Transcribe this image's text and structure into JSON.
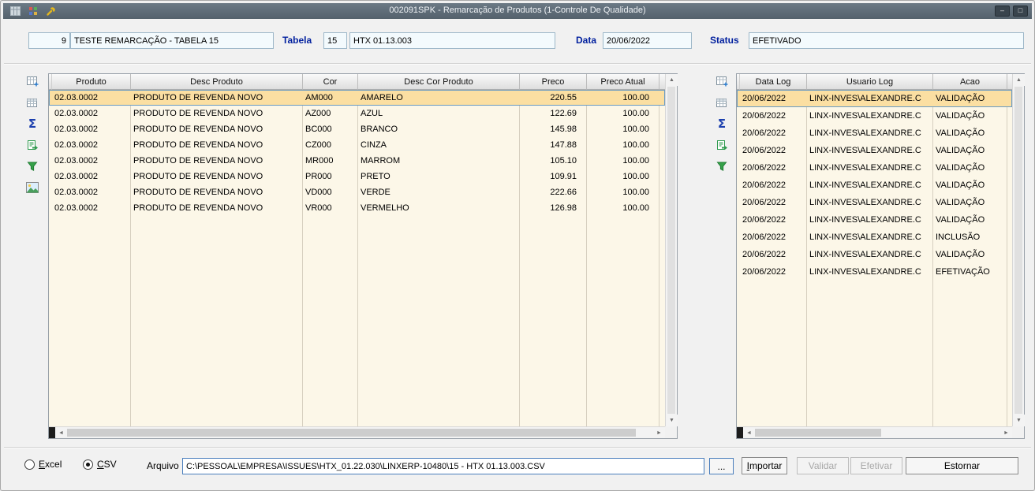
{
  "window": {
    "title": "002091SPK - Remarcação de Produtos (1-Controle De Qualidade)",
    "minimize_glyph": "–",
    "maximize_glyph": "□"
  },
  "header": {
    "record_id": "9",
    "record_description": "TESTE REMARCAÇÃO - TABELA 15",
    "tabela_label": "Tabela",
    "tabela_number": "15",
    "tabela_codigo": "HTX 01.13.003",
    "data_label": "Data",
    "data_value": "20/06/2022",
    "status_label": "Status",
    "status_value": "EFETIVADO"
  },
  "products_grid": {
    "columns": [
      "Produto",
      "Desc Produto",
      "Cor",
      "Desc Cor Produto",
      "Preco",
      "Preco Atual"
    ],
    "rows": [
      [
        "02.03.0002",
        "PRODUTO DE REVENDA NOVO",
        "AM000",
        "AMARELO",
        "220.55",
        "100.00"
      ],
      [
        "02.03.0002",
        "PRODUTO DE REVENDA NOVO",
        "AZ000",
        "AZUL",
        "122.69",
        "100.00"
      ],
      [
        "02.03.0002",
        "PRODUTO DE REVENDA NOVO",
        "BC000",
        "BRANCO",
        "145.98",
        "100.00"
      ],
      [
        "02.03.0002",
        "PRODUTO DE REVENDA NOVO",
        "CZ000",
        "CINZA",
        "147.88",
        "100.00"
      ],
      [
        "02.03.0002",
        "PRODUTO DE REVENDA NOVO",
        "MR000",
        "MARROM",
        "105.10",
        "100.00"
      ],
      [
        "02.03.0002",
        "PRODUTO DE REVENDA NOVO",
        "PR000",
        "PRETO",
        "109.91",
        "100.00"
      ],
      [
        "02.03.0002",
        "PRODUTO DE REVENDA NOVO",
        "VD000",
        "VERDE",
        "222.66",
        "100.00"
      ],
      [
        "02.03.0002",
        "PRODUTO DE REVENDA NOVO",
        "VR000",
        "VERMELHO",
        "126.98",
        "100.00"
      ]
    ]
  },
  "log_grid": {
    "columns": [
      "Data Log",
      "Usuario Log",
      "Acao"
    ],
    "rows": [
      [
        "20/06/2022",
        "LINX-INVES\\ALEXANDRE.C",
        "VALIDAÇÃO"
      ],
      [
        "20/06/2022",
        "LINX-INVES\\ALEXANDRE.C",
        "VALIDAÇÃO"
      ],
      [
        "20/06/2022",
        "LINX-INVES\\ALEXANDRE.C",
        "VALIDAÇÃO"
      ],
      [
        "20/06/2022",
        "LINX-INVES\\ALEXANDRE.C",
        "VALIDAÇÃO"
      ],
      [
        "20/06/2022",
        "LINX-INVES\\ALEXANDRE.C",
        "VALIDAÇÃO"
      ],
      [
        "20/06/2022",
        "LINX-INVES\\ALEXANDRE.C",
        "VALIDAÇÃO"
      ],
      [
        "20/06/2022",
        "LINX-INVES\\ALEXANDRE.C",
        "VALIDAÇÃO"
      ],
      [
        "20/06/2022",
        "LINX-INVES\\ALEXANDRE.C",
        "VALIDAÇÃO"
      ],
      [
        "20/06/2022",
        "LINX-INVES\\ALEXANDRE.C",
        "INCLUSÃO"
      ],
      [
        "20/06/2022",
        "LINX-INVES\\ALEXANDRE.C",
        "VALIDAÇÃO"
      ],
      [
        "20/06/2022",
        "LINX-INVES\\ALEXANDRE.C",
        "EFETIVAÇÃO"
      ]
    ]
  },
  "icons": {
    "sum_glyph": "Σ",
    "scroll_up": "▲",
    "scroll_down": "▼",
    "scroll_left": "◄",
    "scroll_right": "►",
    "toolbar_left": [
      "grid-insert",
      "grid-layout",
      "sum",
      "excel-export",
      "filter",
      "image"
    ],
    "toolbar_right": [
      "grid-insert",
      "grid-layout",
      "sum",
      "excel-export",
      "filter"
    ],
    "titlebar": [
      "grid",
      "colored-grid",
      "wrench"
    ]
  },
  "footer": {
    "excel_label": "Excel",
    "csv_label": "CSV",
    "arquivo_label": "Arquivo",
    "arquivo_path": "C:\\PESSOAL\\EMPRESA\\ISSUES\\HTX_01.22.030\\LINXERP-10480\\15 - HTX 01.13.003.CSV",
    "browse_label": "...",
    "importar_label": "Importar",
    "validar_label": "Validar",
    "efetivar_label": "Efetivar",
    "estornar_label": "Estornar"
  },
  "colors": {
    "titlebar": "#5d6b77",
    "grid_body": "#fcf7e8",
    "selection": "#fbdfa2",
    "label_blue": "#001f9e",
    "accent_green": "#2e9a4e"
  }
}
